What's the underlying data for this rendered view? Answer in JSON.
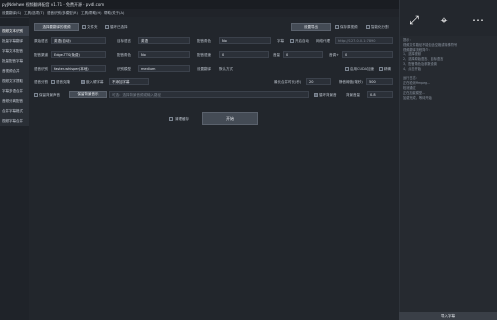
{
  "window": {
    "title": "pyJNdehwe 视频翻译配音 v1.71 · 免费开源 · pvdl.com"
  },
  "menubar": [
    "设置翻译(S)",
    "工具/选项(T)",
    "语音识别/多模型(R)",
    "工具/帮助(H)",
    "帮助/关于(A)"
  ],
  "sidebar": {
    "items": [
      "视频文本识别",
      "批量字幕翻译",
      "字幕文本配音",
      "批量配音字幕",
      "音视频合并",
      "视频文字提取",
      "字幕多语合并",
      "音频分离配音",
      "合并字幕格式",
      "视频字幕合并"
    ],
    "active": 0
  },
  "top": {
    "select_video_button": "选择要翻译的视频",
    "use_folder": "文件夹",
    "loop_selected": "循环已选择",
    "export_button": "设置导出",
    "save_single": "保存原视频",
    "smart_config": "智能化分割"
  },
  "row1": {
    "source_lang_label": "原始语言",
    "source_lang": "英语(自动)",
    "target_lang_label": "目标语言",
    "target_lang": "英语",
    "voice_label": "配音角色",
    "voice": "No",
    "subtitle_label": "字幕",
    "subtitle_option": "开启自动",
    "proxy_label": "网络代理",
    "proxy_placeholder": "http://127.0.0.1:7890"
  },
  "row2": {
    "model_label": "配音渠道",
    "model": "Edge-TTS(免费)",
    "voice_role_label": "配音角色",
    "voice_role": "No",
    "rate_label": "配音语速",
    "rate": "0",
    "volume_label": "音量",
    "volume": "0",
    "pitch_label": "音调+",
    "pitch": "0"
  },
  "row3": {
    "recog_label": "语音识别",
    "recog": "faster-whisper(本地)",
    "model_size_label": "识别模型",
    "model_size": "medium",
    "api_label": "设置翻译",
    "api_value": "默认方式",
    "cuda_label": "启用CUDA加速",
    "cuda_option": "精确"
  },
  "row4": {
    "split_label": "语音分割",
    "voice_clone_label": "语音克隆",
    "subtitle_embed_label": "嵌入硬字幕",
    "subtitle_embed_value": "不添加字幕",
    "max_duration_label": "最长合并时长(秒)",
    "max_duration": "20",
    "silence_label": "静音阈值(毫秒)",
    "silence": "500"
  },
  "row5": {
    "keep_bg_label": "保留背景声音",
    "bg_button": "保留背景音乐",
    "bg_path_placeholder": "可选：选择背景音频或输入路径",
    "loop_bg_label": "循环背景音",
    "bg_volume_label": "背景音量",
    "bg_volume": "0.8"
  },
  "start": {
    "clear_cache_label": "清理缓存",
    "start_button": "开始"
  },
  "right_panel": {
    "icons": [
      "expand-icon",
      "select-text-icon",
      "more-icon"
    ],
    "log": "提示：\n视频文件路径不能包含空格或特殊符号\n视频翻译流程简介：\n1、选择视频\n2、选择原始语言、目标语言\n3、配音角色及参数设置\n4、点击开始\n\n运行日志：\n正在检测ffmpeg...\n检测通过\n正在加载模型...\n加载完成，等待开始",
    "footer": "导入字幕"
  }
}
